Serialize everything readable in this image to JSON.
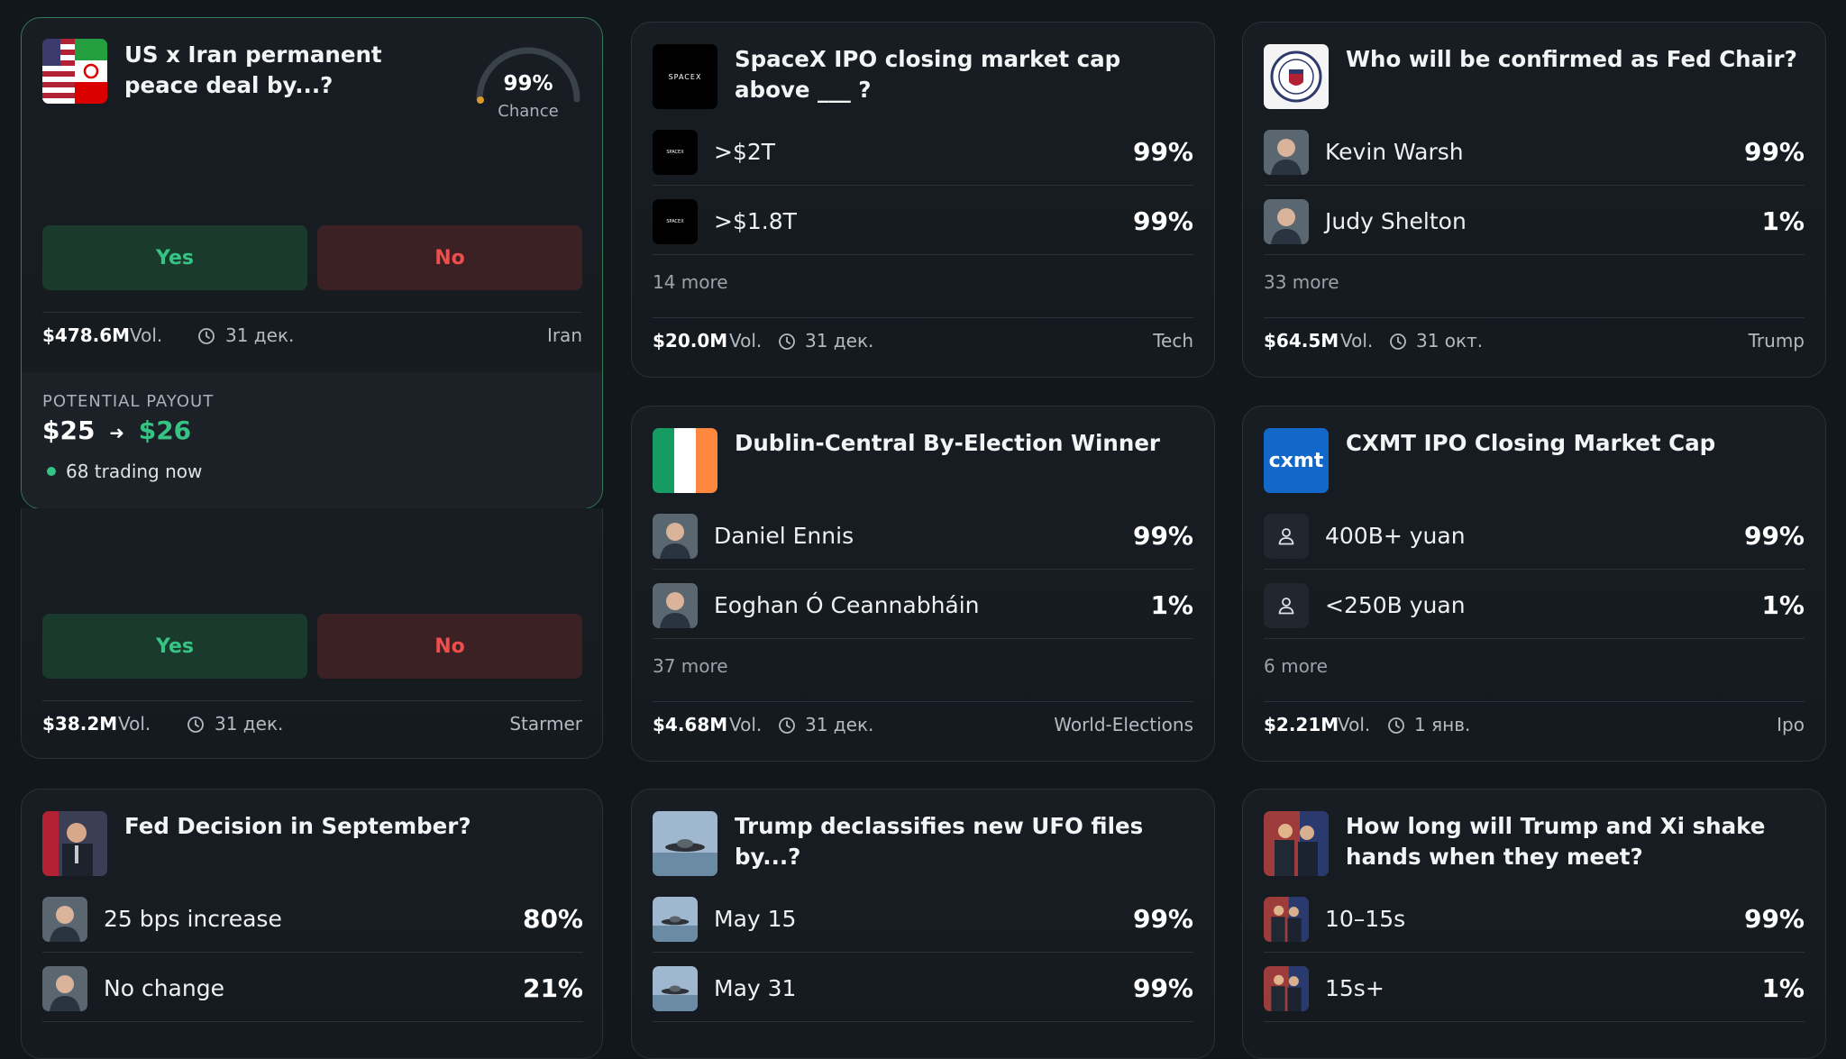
{
  "colors": {
    "background": "#12171c",
    "card": "#171d22",
    "yes": "#35c483",
    "no": "#f04d4d",
    "accent": "#2f7a58"
  },
  "cards": {
    "iran": {
      "title": "US x Iran permanent peace deal by...?",
      "chance_value": "99%",
      "chance_label": "Chance",
      "chance_fraction": 0.99,
      "yes": "Yes",
      "no": "No",
      "volume": "$478.6M",
      "vol_label": "Vol.",
      "date": "31 дек.",
      "tag": "Iran",
      "payout_label": "POTENTIAL PAYOUT",
      "payout_from": "$25",
      "payout_to": "$26",
      "trading_now": "68 trading now"
    },
    "starmer": {
      "yes": "Yes",
      "no": "No",
      "volume": "$38.2M",
      "vol_label": "Vol.",
      "date": "31 дек.",
      "tag": "Starmer"
    },
    "spacex": {
      "title": "SpaceX IPO closing market cap above ___ ?",
      "logo_text": "SPACEX",
      "options": [
        {
          "label": ">$2T",
          "pct": "99%"
        },
        {
          "label": ">$1.8T",
          "pct": "99%"
        }
      ],
      "more": "14 more",
      "volume": "$20.0M",
      "vol_label": "Vol.",
      "date": "31 дек.",
      "tag": "Tech"
    },
    "fedchair": {
      "title": "Who will be confirmed as Fed Chair?",
      "options": [
        {
          "label": "Kevin Warsh",
          "pct": "99%"
        },
        {
          "label": "Judy Shelton",
          "pct": "1%"
        }
      ],
      "more": "33 more",
      "volume": "$64.5M",
      "vol_label": "Vol.",
      "date": "31 окт.",
      "tag": "Trump"
    },
    "dublin": {
      "title": "Dublin-Central By-Election Winner",
      "options": [
        {
          "label": "Daniel Ennis",
          "pct": "99%"
        },
        {
          "label": "Eoghan Ó Ceannabháin",
          "pct": "1%"
        }
      ],
      "more": "37 more",
      "volume": "$4.68M",
      "vol_label": "Vol.",
      "date": "31 дек.",
      "tag": "World-Elections"
    },
    "cxmt": {
      "title": "CXMT IPO Closing Market Cap",
      "logo_text": "cxmt",
      "options": [
        {
          "label": "400B+ yuan",
          "pct": "99%"
        },
        {
          "label": "<250B yuan",
          "pct": "1%"
        }
      ],
      "more": "6 more",
      "volume": "$2.21M",
      "vol_label": "Vol.",
      "date": "1 янв.",
      "tag": "Ipo"
    },
    "fedsept": {
      "title": "Fed Decision in September?",
      "options": [
        {
          "label": "25 bps increase",
          "pct": "80%"
        },
        {
          "label": "No change",
          "pct": "21%"
        }
      ]
    },
    "ufo": {
      "title": "Trump declassifies new UFO files by...?",
      "options": [
        {
          "label": "May 15",
          "pct": "99%"
        },
        {
          "label": "May 31",
          "pct": "99%"
        }
      ]
    },
    "handshake": {
      "title": "How long will Trump and Xi shake hands when they meet?",
      "options": [
        {
          "label": "10–15s",
          "pct": "99%"
        },
        {
          "label": "15s+",
          "pct": "1%"
        }
      ]
    }
  }
}
